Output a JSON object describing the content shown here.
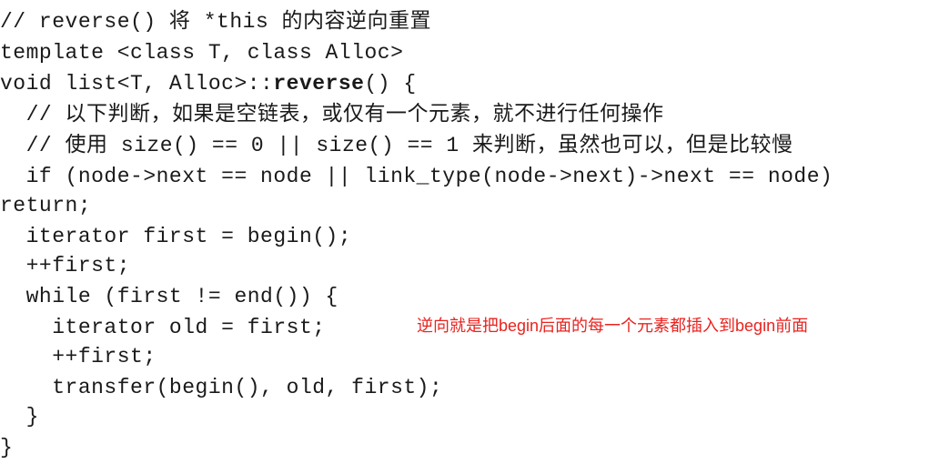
{
  "code": {
    "lines": [
      "// reverse() 将 *this 的内容逆向重置",
      "template <class T, class Alloc>",
      "void list<T, Alloc>::",
      "  // 以下判断，如果是空链表，或仅有一个元素，就不进行任何操作",
      "  // 使用 size() == 0 || size() == 1 来判断，虽然也可以，但是比较慢",
      "  if (node->next == node || link_type(node->next)->next == node)",
      "return;",
      "  iterator first = begin();",
      "  ++first;",
      "  while (first != end()) {",
      "    iterator old = first;",
      "    ++first;",
      "    transfer(begin(), old, first);",
      "  }",
      "}"
    ],
    "bold_name": "reverse",
    "line3_tail": "() {"
  },
  "annotation": {
    "text": "逆向就是把begin后面的每一个元素都插入到begin前面",
    "color": "#e8231f"
  }
}
